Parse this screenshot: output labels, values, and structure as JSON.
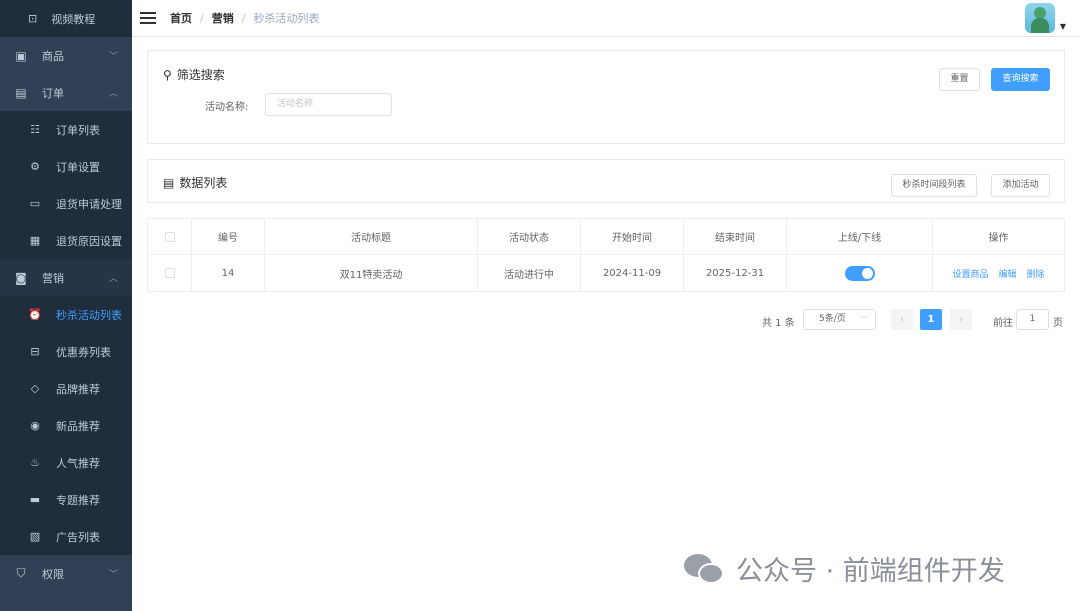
{
  "sidebar": {
    "top_item": {
      "icon": "video-icon",
      "label": "视频教程"
    },
    "items": [
      {
        "icon": "goods-icon",
        "label": "商品",
        "expanded": false
      },
      {
        "icon": "order-icon",
        "label": "订单",
        "expanded": true
      },
      {
        "icon": "marketing-icon",
        "label": "营销",
        "expanded": true
      },
      {
        "icon": "permission-icon",
        "label": "权限",
        "expanded": false
      }
    ],
    "order_children": [
      {
        "icon": "list-icon",
        "label": "订单列表"
      },
      {
        "icon": "gear-icon",
        "label": "订单设置"
      },
      {
        "icon": "return-icon",
        "label": "退货申请处理"
      },
      {
        "icon": "reason-icon",
        "label": "退货原因设置"
      }
    ],
    "marketing_children": [
      {
        "icon": "clock-icon",
        "label": "秒杀活动列表",
        "active": true
      },
      {
        "icon": "coupon-icon",
        "label": "优惠券列表"
      },
      {
        "icon": "tag-icon",
        "label": "品牌推荐"
      },
      {
        "icon": "new-icon",
        "label": "新品推荐"
      },
      {
        "icon": "fire-icon",
        "label": "人气推荐"
      },
      {
        "icon": "topic-icon",
        "label": "专题推荐"
      },
      {
        "icon": "ad-icon",
        "label": "广告列表"
      }
    ]
  },
  "header": {
    "breadcrumb": [
      "首页",
      "营销",
      "秒杀活动列表"
    ]
  },
  "filter": {
    "title": "筛选搜索",
    "field_label": "活动名称:",
    "field_placeholder": "活动名称",
    "reset_label": "重置",
    "search_label": "查询搜索"
  },
  "list": {
    "title": "数据列表",
    "time_slot_label": "秒杀时间段列表",
    "add_label": "添加活动"
  },
  "table": {
    "columns": [
      "编号",
      "活动标题",
      "活动状态",
      "开始时间",
      "结束时间",
      "上线/下线",
      "操作"
    ],
    "rows": [
      {
        "id": "14",
        "title": "双11特卖活动",
        "status": "活动进行中",
        "start": "2024-11-09",
        "end": "2025-12-31",
        "online": true,
        "ops": [
          "设置商品",
          "编辑",
          "删除"
        ]
      }
    ]
  },
  "pagination": {
    "total": "共 1 条",
    "page_size": "5条/页",
    "prev": "‹",
    "current": "1",
    "next": "›",
    "goto_label": "前往",
    "goto_value": "1",
    "page_word": "页"
  },
  "watermark": {
    "text": "公众号 · 前端组件开发"
  },
  "colors": {
    "sidebar_bg": "#304156",
    "primary": "#409eff"
  }
}
